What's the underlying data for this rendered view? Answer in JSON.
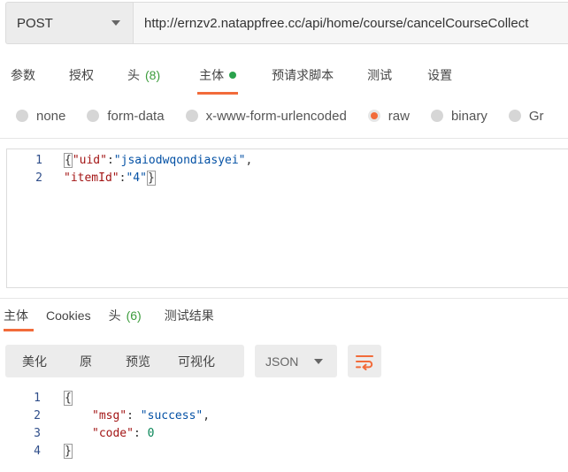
{
  "request": {
    "method": "POST",
    "url": "http://ernzv2.natappfree.cc/api/home/course/cancelCourseCollect"
  },
  "request_tabs": [
    {
      "label": "参数"
    },
    {
      "label": "授权"
    },
    {
      "label": "头",
      "count": "(8)"
    },
    {
      "label": "主体"
    },
    {
      "label": "预请求脚本"
    },
    {
      "label": "测试"
    },
    {
      "label": "设置"
    }
  ],
  "body_types": [
    {
      "label": "none"
    },
    {
      "label": "form-data"
    },
    {
      "label": "x-www-form-urlencoded"
    },
    {
      "label": "raw"
    },
    {
      "label": "binary"
    },
    {
      "label": "Gr"
    }
  ],
  "request_body": {
    "line_numbers": [
      "1",
      "2"
    ],
    "line1": {
      "open": "{",
      "key": "\"uid\"",
      "colon": ":",
      "value": "\"jsaiodwqondiasyei\"",
      "comma": ","
    },
    "line2": {
      "key": "\"itemId\"",
      "colon": ":",
      "value": "\"4\"",
      "close": "}"
    }
  },
  "response_tabs": [
    {
      "label": "主体"
    },
    {
      "label": "Cookies"
    },
    {
      "label": "头",
      "count": "(6)"
    },
    {
      "label": "测试结果"
    }
  ],
  "response_toolbar": {
    "views": [
      "美化",
      "原",
      "预览",
      "可视化"
    ],
    "format": "JSON"
  },
  "response_body": {
    "line_numbers": [
      "1",
      "2",
      "3",
      "4"
    ],
    "open": "{",
    "msg_key": "\"msg\"",
    "msg_value": "\"success\"",
    "code_key": "\"code\"",
    "code_value": "0",
    "close": "}"
  },
  "colors": {
    "accent": "#f26b3a",
    "active_dot": "#2aa24c",
    "count_green": "#3c9c3c"
  }
}
